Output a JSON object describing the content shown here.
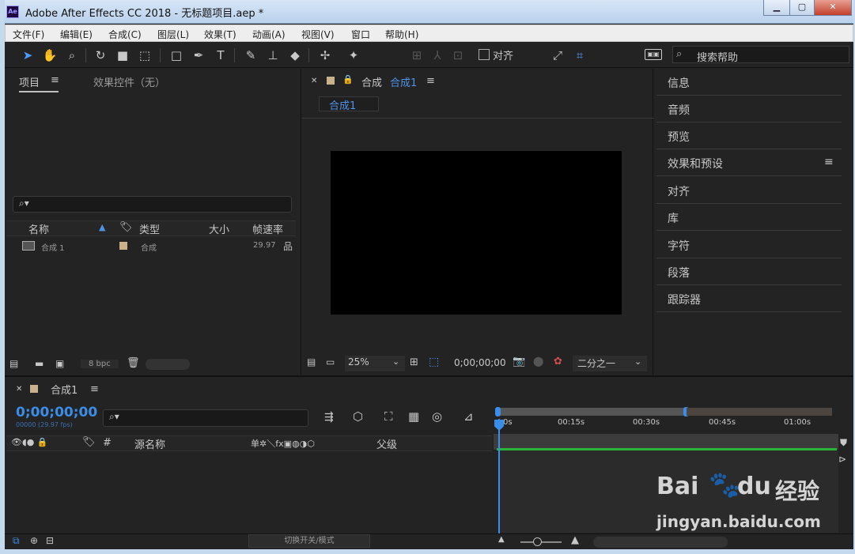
{
  "window": {
    "title": "Adobe After Effects CC 2018 - 无标题项目.aep *",
    "logo": "Ae",
    "minimize": "▁",
    "maximize": "▢",
    "close": "✕"
  },
  "menu": [
    "文件(F)",
    "编辑(E)",
    "合成(C)",
    "图层(L)",
    "效果(T)",
    "动画(A)",
    "视图(V)",
    "窗口",
    "帮助(H)"
  ],
  "toolbar": {
    "align_label": "对齐",
    "help_placeholder": "搜索帮助"
  },
  "project_panel": {
    "tab_project": "项目",
    "tab_effects": "效果控件（无）",
    "columns": {
      "name": "名称",
      "type": "类型",
      "size": "大小",
      "fps": "帧速率"
    },
    "items": [
      {
        "name": "合成 1",
        "type": "合成",
        "fps": "29.97"
      }
    ],
    "bpc": "8 bpc"
  },
  "comp_panel": {
    "header_prefix": "合成",
    "header_name": "合成1",
    "tab": "合成1",
    "zoom": "25%",
    "timecode": "0;00;00;00",
    "resolution": "二分之一"
  },
  "right_panels": [
    "信息",
    "音频",
    "预览",
    "效果和预设",
    "对齐",
    "库",
    "字符",
    "段落",
    "跟踪器"
  ],
  "timeline": {
    "tab": "合成1",
    "timecode": "0;00;00;00",
    "frames": "00000 (29.97 fps)",
    "columns": {
      "hash": "#",
      "source": "源名称",
      "parent": "父级"
    },
    "switch_icons": "单✲＼fx▣◍◑⬡",
    "ruler": [
      "0s",
      "00:15s",
      "00:30s",
      "00:45s",
      "01:00s"
    ],
    "toggle_label": "切换开关/模式"
  },
  "watermark": {
    "brand": "Bai",
    "du": "du",
    "jingyan": "经验",
    "url": "jingyan.baidu.com"
  },
  "colors": {
    "accent": "#3b8dea",
    "label_swatch": "#c9b28b",
    "work_area": "#2bb43a"
  }
}
